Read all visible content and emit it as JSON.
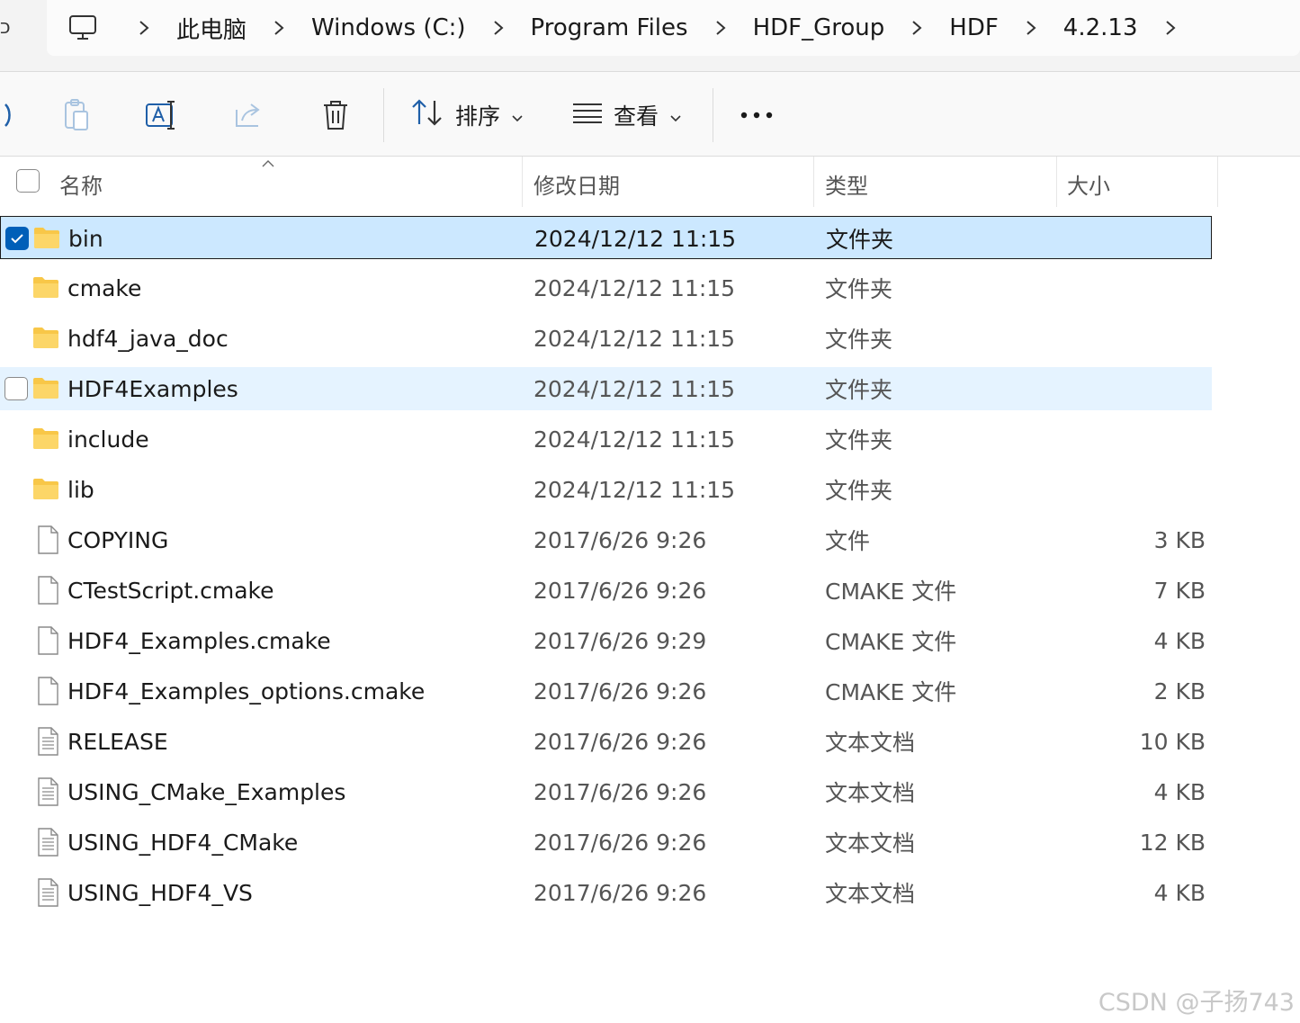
{
  "address": {
    "edge_glyph": "כ",
    "crumbs": [
      "此电脑",
      "Windows (C:)",
      "Program Files",
      "HDF_Group",
      "HDF",
      "4.2.13"
    ]
  },
  "toolbar": {
    "sort_label": "排序",
    "view_label": "查看"
  },
  "columns": {
    "name": "名称",
    "date": "修改日期",
    "type": "类型",
    "size": "大小"
  },
  "files": [
    {
      "name": "bin",
      "date": "2024/12/12 11:15",
      "type": "文件夹",
      "size": "",
      "kind": "folder",
      "state": "selected"
    },
    {
      "name": "cmake",
      "date": "2024/12/12 11:15",
      "type": "文件夹",
      "size": "",
      "kind": "folder",
      "state": ""
    },
    {
      "name": "hdf4_java_doc",
      "date": "2024/12/12 11:15",
      "type": "文件夹",
      "size": "",
      "kind": "folder",
      "state": ""
    },
    {
      "name": "HDF4Examples",
      "date": "2024/12/12 11:15",
      "type": "文件夹",
      "size": "",
      "kind": "folder",
      "state": "hover"
    },
    {
      "name": "include",
      "date": "2024/12/12 11:15",
      "type": "文件夹",
      "size": "",
      "kind": "folder",
      "state": ""
    },
    {
      "name": "lib",
      "date": "2024/12/12 11:15",
      "type": "文件夹",
      "size": "",
      "kind": "folder",
      "state": ""
    },
    {
      "name": "COPYING",
      "date": "2017/6/26 9:26",
      "type": "文件",
      "size": "3 KB",
      "kind": "file",
      "state": ""
    },
    {
      "name": "CTestScript.cmake",
      "date": "2017/6/26 9:26",
      "type": "CMAKE 文件",
      "size": "7 KB",
      "kind": "file",
      "state": ""
    },
    {
      "name": "HDF4_Examples.cmake",
      "date": "2017/6/26 9:29",
      "type": "CMAKE 文件",
      "size": "4 KB",
      "kind": "file",
      "state": ""
    },
    {
      "name": "HDF4_Examples_options.cmake",
      "date": "2017/6/26 9:26",
      "type": "CMAKE 文件",
      "size": "2 KB",
      "kind": "file",
      "state": ""
    },
    {
      "name": "RELEASE",
      "date": "2017/6/26 9:26",
      "type": "文本文档",
      "size": "10 KB",
      "kind": "text",
      "state": ""
    },
    {
      "name": "USING_CMake_Examples",
      "date": "2017/6/26 9:26",
      "type": "文本文档",
      "size": "4 KB",
      "kind": "text",
      "state": ""
    },
    {
      "name": "USING_HDF4_CMake",
      "date": "2017/6/26 9:26",
      "type": "文本文档",
      "size": "12 KB",
      "kind": "text",
      "state": ""
    },
    {
      "name": "USING_HDF4_VS",
      "date": "2017/6/26 9:26",
      "type": "文本文档",
      "size": "4 KB",
      "kind": "text",
      "state": ""
    }
  ],
  "icons": {
    "pc": "computer-icon",
    "chevron": "chevron-right-icon",
    "paste": "paste-icon",
    "rename": "rename-icon",
    "share": "share-icon",
    "delete": "trash-icon",
    "sort": "sort-arrows-icon",
    "view": "view-lines-icon",
    "more": "more-icon"
  },
  "colors": {
    "selected_bg": "#cce8ff",
    "hover_bg": "#e5f3ff",
    "check_accent": "#005fb8",
    "folder": "#f8c748"
  },
  "watermark": "CSDN @子扬743"
}
